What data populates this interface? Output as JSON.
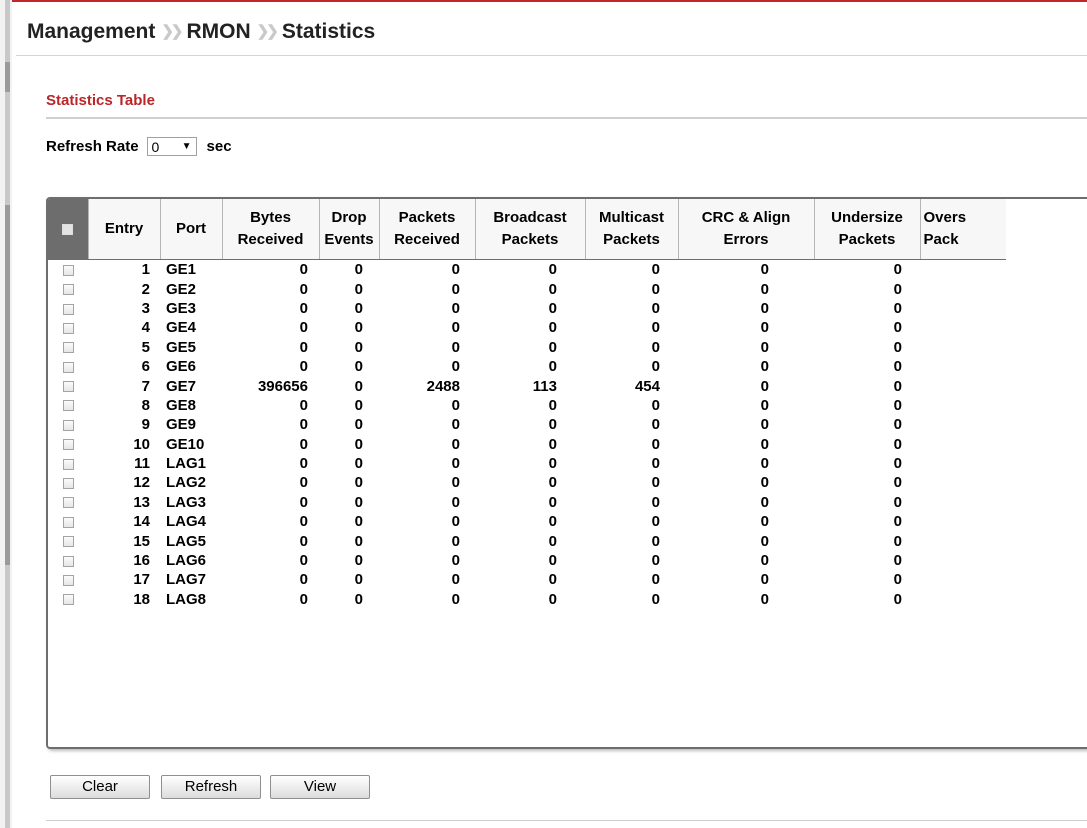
{
  "breadcrumb": [
    "Management",
    "RMON",
    "Statistics"
  ],
  "section_title": "Statistics Table",
  "refresh": {
    "label": "Refresh Rate",
    "value": "0",
    "unit": "sec"
  },
  "table": {
    "headers": {
      "entry": "Entry",
      "port": "Port",
      "bytes_received": [
        "Bytes",
        "Received"
      ],
      "drop_events": [
        "Drop",
        "Events"
      ],
      "packets_received": [
        "Packets",
        "Received"
      ],
      "broadcast_packets": [
        "Broadcast",
        "Packets"
      ],
      "multicast_packets": [
        "Multicast",
        "Packets"
      ],
      "crc_align_errors": [
        "CRC & Align",
        "Errors"
      ],
      "undersize_packets": [
        "Undersize",
        "Packets"
      ],
      "oversize_packets": [
        "Overs",
        "Pack"
      ]
    },
    "rows": [
      {
        "entry": "1",
        "port": "GE1",
        "bytes": "0",
        "drop": "0",
        "packets": "0",
        "broadcast": "0",
        "multicast": "0",
        "crc": "0",
        "undersize": "0"
      },
      {
        "entry": "2",
        "port": "GE2",
        "bytes": "0",
        "drop": "0",
        "packets": "0",
        "broadcast": "0",
        "multicast": "0",
        "crc": "0",
        "undersize": "0"
      },
      {
        "entry": "3",
        "port": "GE3",
        "bytes": "0",
        "drop": "0",
        "packets": "0",
        "broadcast": "0",
        "multicast": "0",
        "crc": "0",
        "undersize": "0"
      },
      {
        "entry": "4",
        "port": "GE4",
        "bytes": "0",
        "drop": "0",
        "packets": "0",
        "broadcast": "0",
        "multicast": "0",
        "crc": "0",
        "undersize": "0"
      },
      {
        "entry": "5",
        "port": "GE5",
        "bytes": "0",
        "drop": "0",
        "packets": "0",
        "broadcast": "0",
        "multicast": "0",
        "crc": "0",
        "undersize": "0"
      },
      {
        "entry": "6",
        "port": "GE6",
        "bytes": "0",
        "drop": "0",
        "packets": "0",
        "broadcast": "0",
        "multicast": "0",
        "crc": "0",
        "undersize": "0"
      },
      {
        "entry": "7",
        "port": "GE7",
        "bytes": "396656",
        "drop": "0",
        "packets": "2488",
        "broadcast": "113",
        "multicast": "454",
        "crc": "0",
        "undersize": "0"
      },
      {
        "entry": "8",
        "port": "GE8",
        "bytes": "0",
        "drop": "0",
        "packets": "0",
        "broadcast": "0",
        "multicast": "0",
        "crc": "0",
        "undersize": "0"
      },
      {
        "entry": "9",
        "port": "GE9",
        "bytes": "0",
        "drop": "0",
        "packets": "0",
        "broadcast": "0",
        "multicast": "0",
        "crc": "0",
        "undersize": "0"
      },
      {
        "entry": "10",
        "port": "GE10",
        "bytes": "0",
        "drop": "0",
        "packets": "0",
        "broadcast": "0",
        "multicast": "0",
        "crc": "0",
        "undersize": "0"
      },
      {
        "entry": "11",
        "port": "LAG1",
        "bytes": "0",
        "drop": "0",
        "packets": "0",
        "broadcast": "0",
        "multicast": "0",
        "crc": "0",
        "undersize": "0"
      },
      {
        "entry": "12",
        "port": "LAG2",
        "bytes": "0",
        "drop": "0",
        "packets": "0",
        "broadcast": "0",
        "multicast": "0",
        "crc": "0",
        "undersize": "0"
      },
      {
        "entry": "13",
        "port": "LAG3",
        "bytes": "0",
        "drop": "0",
        "packets": "0",
        "broadcast": "0",
        "multicast": "0",
        "crc": "0",
        "undersize": "0"
      },
      {
        "entry": "14",
        "port": "LAG4",
        "bytes": "0",
        "drop": "0",
        "packets": "0",
        "broadcast": "0",
        "multicast": "0",
        "crc": "0",
        "undersize": "0"
      },
      {
        "entry": "15",
        "port": "LAG5",
        "bytes": "0",
        "drop": "0",
        "packets": "0",
        "broadcast": "0",
        "multicast": "0",
        "crc": "0",
        "undersize": "0"
      },
      {
        "entry": "16",
        "port": "LAG6",
        "bytes": "0",
        "drop": "0",
        "packets": "0",
        "broadcast": "0",
        "multicast": "0",
        "crc": "0",
        "undersize": "0"
      },
      {
        "entry": "17",
        "port": "LAG7",
        "bytes": "0",
        "drop": "0",
        "packets": "0",
        "broadcast": "0",
        "multicast": "0",
        "crc": "0",
        "undersize": "0"
      },
      {
        "entry": "18",
        "port": "LAG8",
        "bytes": "0",
        "drop": "0",
        "packets": "0",
        "broadcast": "0",
        "multicast": "0",
        "crc": "0",
        "undersize": "0"
      }
    ]
  },
  "buttons": {
    "clear": "Clear",
    "refresh": "Refresh",
    "view": "View"
  },
  "colors": {
    "accent": "#b9262a",
    "top_line": "#c0272d"
  },
  "icons": {
    "breadcrumb_separator": "double-chevron-right-icon",
    "dropdown": "dropdown-arrow-icon"
  }
}
